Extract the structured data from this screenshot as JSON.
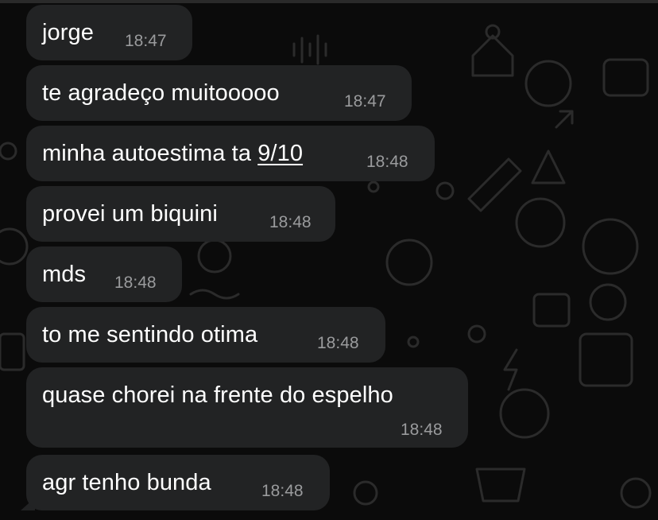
{
  "messages": [
    {
      "pre": "jorge",
      "link": "",
      "time": "18:47"
    },
    {
      "pre": "te agradeço muitooooo",
      "link": "",
      "time": "18:47"
    },
    {
      "pre": "minha autoestima ta ",
      "link": "9/10",
      "time": "18:48"
    },
    {
      "pre": "provei um biquini",
      "link": "",
      "time": "18:48"
    },
    {
      "pre": "mds",
      "link": "",
      "time": "18:48"
    },
    {
      "pre": "to me sentindo otima",
      "link": "",
      "time": "18:48"
    },
    {
      "pre": "quase chorei na frente do espelho",
      "link": "",
      "time": "18:48"
    },
    {
      "pre": "agr tenho bunda",
      "link": "",
      "time": "18:48"
    }
  ],
  "colors": {
    "background": "#0b0b0b",
    "bubble": "#222324",
    "text": "#ffffff",
    "timestamp": "#9a9b9d"
  }
}
